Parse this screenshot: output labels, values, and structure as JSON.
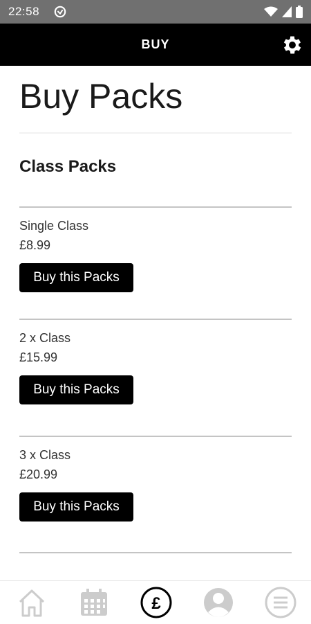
{
  "status_bar": {
    "time": "22:58"
  },
  "app_bar": {
    "title": "BUY"
  },
  "page": {
    "title": "Buy Packs",
    "section_title": "Class Packs"
  },
  "packs": [
    {
      "name": "Single Class",
      "price": "£8.99",
      "button_label": "Buy this Packs"
    },
    {
      "name": "2 x Class",
      "price": "£15.99",
      "button_label": "Buy this Packs"
    },
    {
      "name": "3 x Class",
      "price": "£20.99",
      "button_label": "Buy this Packs"
    }
  ],
  "bottom_nav": {
    "items": [
      {
        "icon": "home-icon",
        "active": false
      },
      {
        "icon": "calendar-icon",
        "active": false
      },
      {
        "icon": "pound-icon",
        "active": true
      },
      {
        "icon": "profile-icon",
        "active": false
      },
      {
        "icon": "menu-icon",
        "active": false
      }
    ]
  },
  "colors": {
    "app_bar": "#000000",
    "status_bar": "#707070",
    "button": "#000000",
    "inactive_icon": "#cccccc",
    "active_icon": "#000000"
  }
}
